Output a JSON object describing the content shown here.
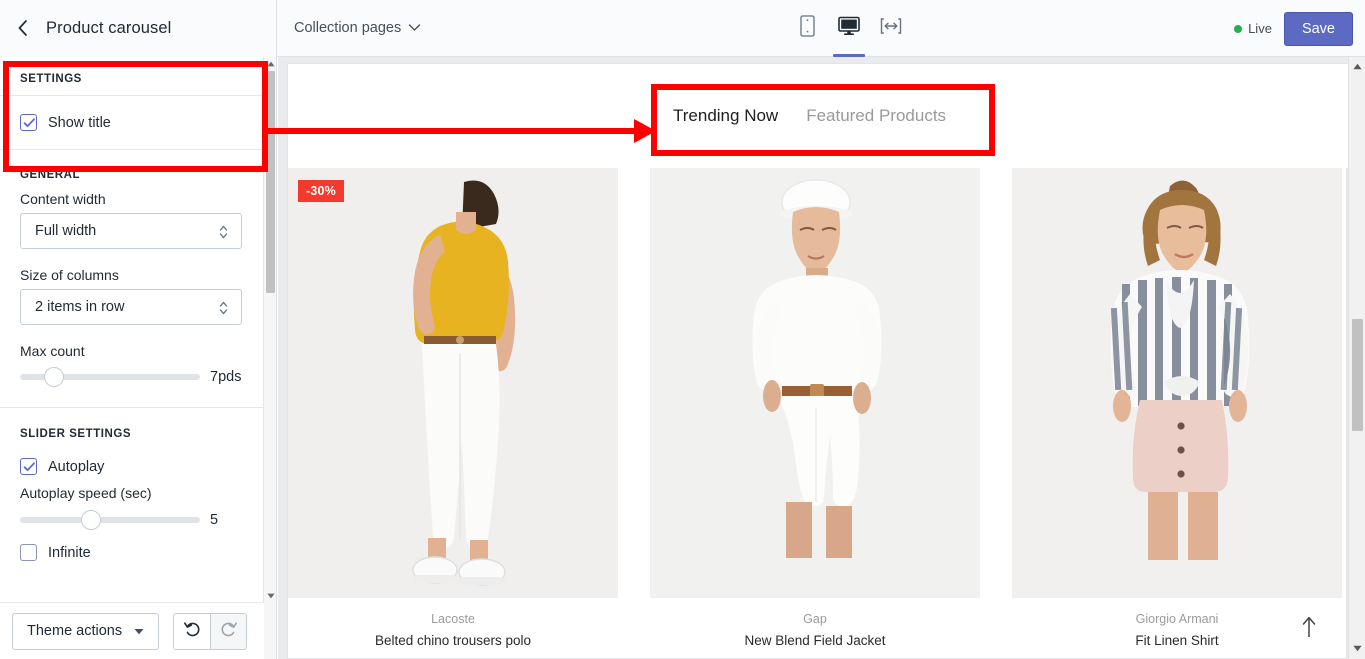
{
  "header": {
    "back_icon": "chevron-left-icon",
    "title": "Product carousel",
    "page_selector_label": "Collection pages",
    "page_selector_icon": "chevron-down-icon",
    "devices": [
      {
        "name": "mobile",
        "icon": "mobile-icon",
        "active": false
      },
      {
        "name": "desktop",
        "icon": "desktop-icon",
        "active": true
      },
      {
        "name": "fullscreen",
        "icon": "fullwidth-icon",
        "active": false
      }
    ],
    "status_label": "Live",
    "status_color": "#21b24b",
    "save_label": "Save",
    "save_color": "#5c6ac4"
  },
  "sidebar": {
    "settings": {
      "heading": "SETTINGS",
      "show_title_label": "Show title",
      "show_title_checked": true
    },
    "general": {
      "heading": "GENERAL",
      "content_width_label": "Content width",
      "content_width_value": "Full width",
      "size_columns_label": "Size of columns",
      "size_columns_value": "2 items in row",
      "max_count_label": "Max count",
      "max_count_value": "7pds",
      "max_count_percent": 15
    },
    "slider_settings": {
      "heading": "SLIDER SETTINGS",
      "autoplay_label": "Autoplay",
      "autoplay_checked": true,
      "autoplay_speed_label": "Autoplay speed (sec)",
      "autoplay_speed_value": "5",
      "autoplay_speed_percent": 38,
      "infinite_label": "Infinite"
    },
    "bottom": {
      "theme_actions_label": "Theme actions",
      "theme_actions_icon": "caret-down-icon",
      "undo_icon": "undo-icon",
      "redo_icon": "redo-icon"
    }
  },
  "preview": {
    "tabs": [
      {
        "label": "Trending Now",
        "active": true
      },
      {
        "label": "Featured Products",
        "active": false
      }
    ],
    "products": [
      {
        "brand": "Lacoste",
        "name": "Belted chino trousers polo",
        "badge": "-30%",
        "badge_color": "#f4392e"
      },
      {
        "brand": "Gap",
        "name": "New Blend Field Jacket",
        "badge": "",
        "badge_color": ""
      },
      {
        "brand": "Giorgio Armani",
        "name": "Fit Linen Shirt",
        "badge": "",
        "badge_color": ""
      }
    ],
    "back_to_top_icon": "arrow-up-icon"
  },
  "annotations": {
    "highlight_color": "#ff0000",
    "boxes": [
      "settings-panel-highlight",
      "preview-tabs-highlight"
    ],
    "arrow": "settings-to-tabs-arrow"
  }
}
